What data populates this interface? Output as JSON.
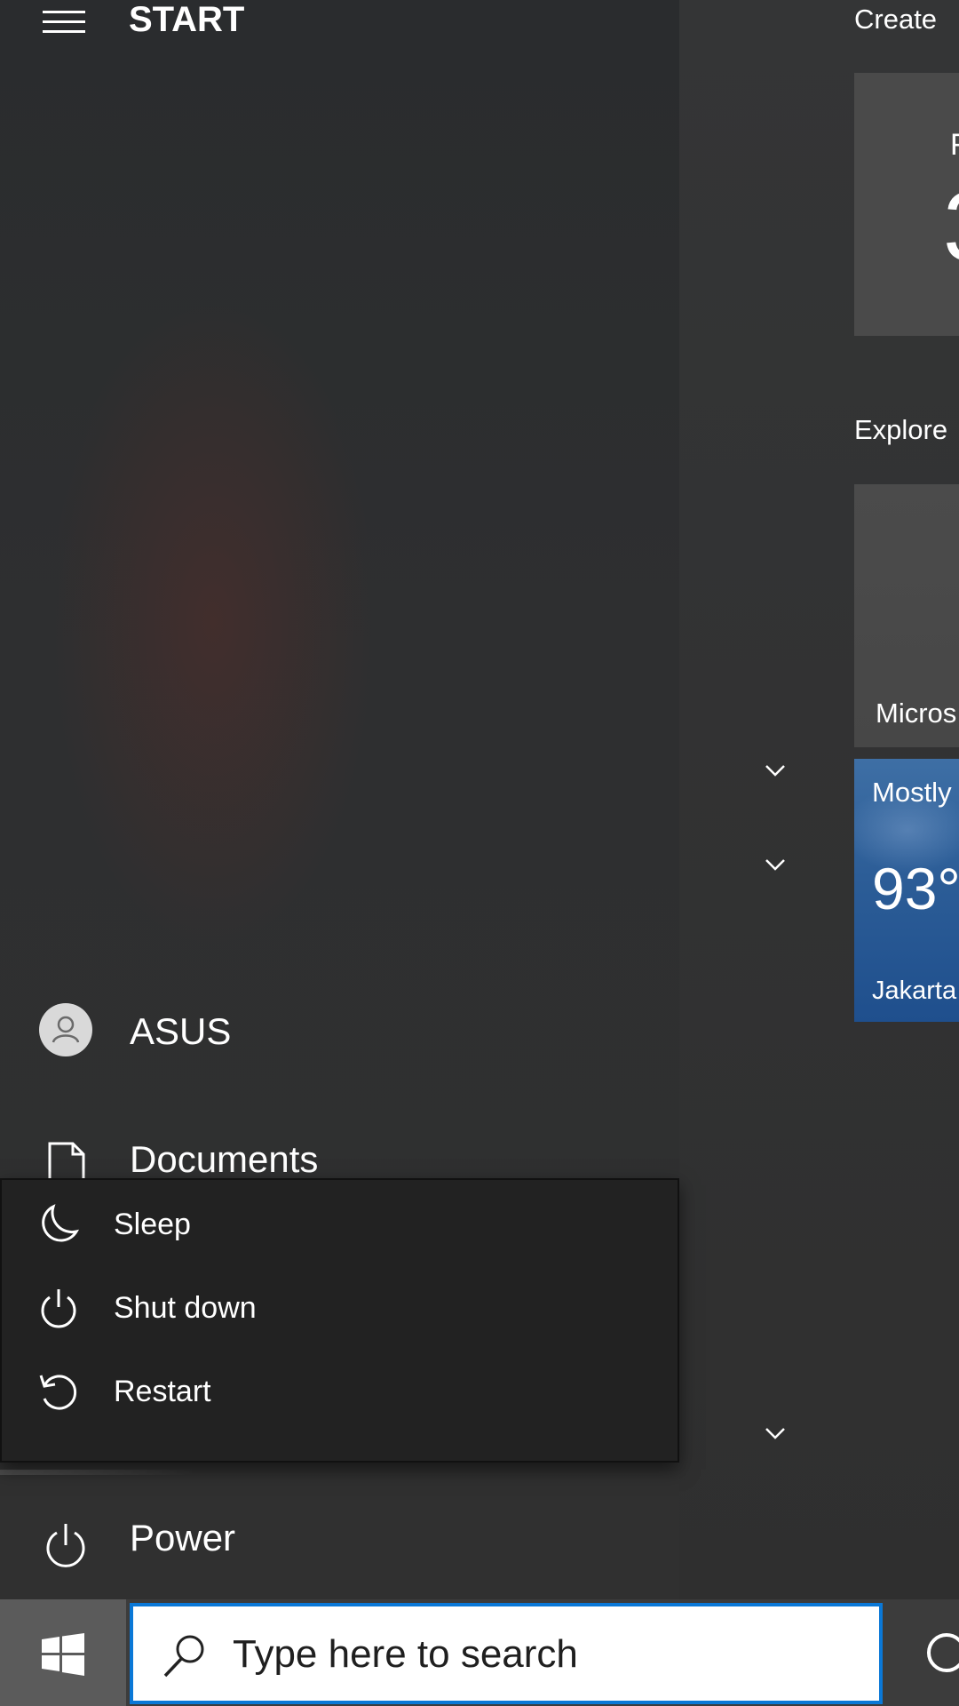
{
  "start_menu": {
    "title": "START",
    "groups": {
      "create": "Create",
      "explore": "Explore"
    },
    "tiles": {
      "calendar": {
        "line1": "F",
        "line2": "3"
      },
      "store": {
        "label": "Micros"
      },
      "weather": {
        "condition": "Mostly",
        "temperature": "93°",
        "city": "Jakarta"
      }
    },
    "rail": {
      "user": "ASUS",
      "documents": "Documents",
      "power": "Power"
    },
    "power_flyout": {
      "sleep": "Sleep",
      "shutdown": "Shut down",
      "restart": "Restart"
    }
  },
  "taskbar": {
    "search_placeholder": "Type here to search",
    "accent": "#0a78d7"
  },
  "icons": {
    "hamburger": "hamburger-menu-icon",
    "avatar": "user-avatar-icon",
    "documents": "document-icon",
    "power": "power-icon",
    "sleep": "moon-icon",
    "shutdown": "power-icon",
    "restart": "restart-icon",
    "start": "windows-logo-icon",
    "search": "search-icon",
    "cortana": "cortana-icon",
    "chevron": "chevron-down-icon"
  }
}
